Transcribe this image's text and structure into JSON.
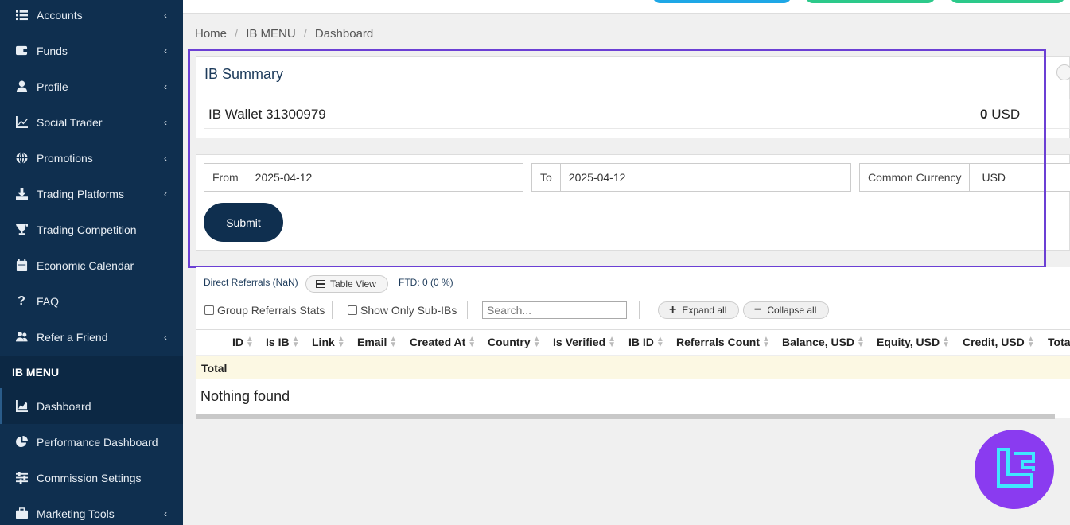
{
  "sidebar": {
    "items": [
      {
        "label": "Accounts",
        "icon": "list-icon",
        "chevron": true
      },
      {
        "label": "Funds",
        "icon": "wallet-icon",
        "chevron": true
      },
      {
        "label": "Profile",
        "icon": "user-icon",
        "chevron": true
      },
      {
        "label": "Social Trader",
        "icon": "chart-line-icon",
        "chevron": true
      },
      {
        "label": "Promotions",
        "icon": "globe-icon",
        "chevron": true
      },
      {
        "label": "Trading Platforms",
        "icon": "download-icon",
        "chevron": true
      },
      {
        "label": "Trading Competition",
        "icon": "trophy-icon",
        "chevron": false
      },
      {
        "label": "Economic Calendar",
        "icon": "calendar-icon",
        "chevron": false
      },
      {
        "label": "FAQ",
        "icon": "question-icon",
        "chevron": false
      },
      {
        "label": "Refer a Friend",
        "icon": "users-icon",
        "chevron": true
      }
    ],
    "section_header": "IB MENU",
    "ib_items": [
      {
        "label": "Dashboard",
        "icon": "chart-area-icon",
        "chevron": false
      },
      {
        "label": "Performance Dashboard",
        "icon": "pie-chart-icon",
        "chevron": false
      },
      {
        "label": "Commission Settings",
        "icon": "sliders-icon",
        "chevron": false
      },
      {
        "label": "Marketing Tools",
        "icon": "briefcase-icon",
        "chevron": true
      }
    ],
    "chevron_glyph": "‹"
  },
  "breadcrumb": {
    "home": "Home",
    "section": "IB MENU",
    "current": "Dashboard",
    "separator": "/"
  },
  "summary": {
    "title": "IB Summary",
    "wallet_label": "IB Wallet 31300979",
    "wallet_amount": "0",
    "wallet_currency": "USD"
  },
  "filters": {
    "from_label": "From",
    "from_value": "2025-04-12",
    "to_label": "To",
    "to_value": "2025-04-12",
    "currency_label": "Common Currency",
    "currency_value": "USD",
    "submit_label": "Submit"
  },
  "referrals": {
    "direct_label": "Direct Referrals (NaN)",
    "table_view_label": "Table View",
    "ftd_label": "FTD: 0 (0 %)",
    "group_stats_label": "Group Referrals Stats",
    "sub_ibs_label": "Show Only Sub-IBs",
    "search_placeholder": "Search...",
    "expand_label": "Expand all",
    "collapse_label": "Collapse all",
    "columns": [
      "ID",
      "Is IB",
      "Link",
      "Email",
      "Created At",
      "Country",
      "Is Verified",
      "IB ID",
      "Referrals Count",
      "Balance, USD",
      "Equity, USD",
      "Credit, USD",
      "Tota"
    ],
    "total_label": "Total",
    "empty_message": "Nothing found"
  },
  "colors": {
    "sidebar_bg": "#0f2f4f",
    "highlight_border": "#6b3fd4",
    "total_row_bg": "#fcf8e3",
    "logo_bg": "#8a3bf0"
  }
}
